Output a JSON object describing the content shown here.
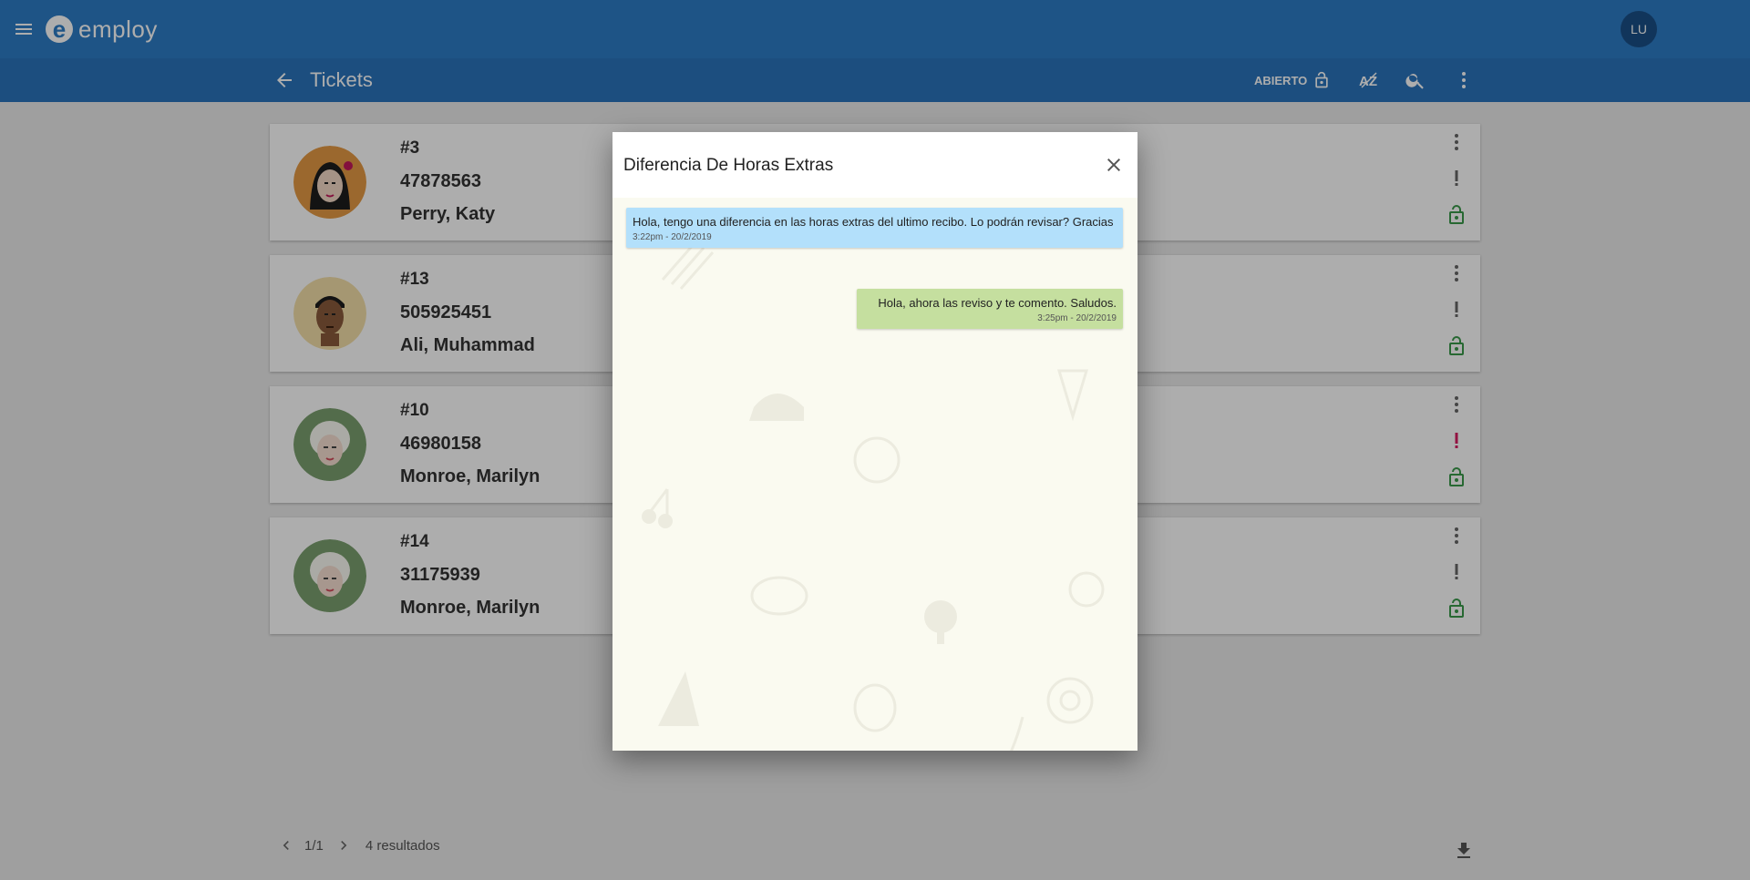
{
  "app": {
    "logo_text": "employ",
    "user_initials": "LU"
  },
  "toolbar": {
    "title": "Tickets",
    "filter_state": "ABIERTO",
    "icons": [
      "back-arrow-icon",
      "lock-open-icon",
      "sort-az-icon",
      "search-icon",
      "more-vert-icon"
    ]
  },
  "tickets": [
    {
      "number": "#3",
      "ci": "47878563",
      "name": "Perry, Katy",
      "priority": "normal",
      "status": "open"
    },
    {
      "number": "#13",
      "ci": "505925451",
      "name": "Ali, Muhammad",
      "priority": "normal",
      "status": "open"
    },
    {
      "number": "#10",
      "ci": "46980158",
      "name": "Monroe, Marilyn",
      "priority": "high",
      "status": "open"
    },
    {
      "number": "#14",
      "ci": "31175939",
      "name": "Monroe, Marilyn",
      "priority": "normal",
      "status": "open"
    }
  ],
  "pagination": {
    "page": "1/1",
    "results": "4 resultados"
  },
  "modal": {
    "title": "Diferencia De Horas Extras",
    "messages": [
      {
        "direction": "in",
        "text": "Hola, tengo una diferencia en las horas extras del ultimo recibo. Lo podrán revisar? Gracias",
        "time": "3:22pm - 20/2/2019"
      },
      {
        "direction": "out",
        "text": "Hola, ahora las reviso y te comento. Saludos.",
        "time": "3:25pm - 20/2/2019"
      }
    ]
  },
  "colors": {
    "appbar": "#2d7cc6",
    "subbar": "#2a74bc",
    "incoming_bubble": "#b3e0fb",
    "outgoing_bubble": "#c5df9f",
    "lock_green": "#3a9a4a",
    "priority_high": "#d81b60"
  }
}
